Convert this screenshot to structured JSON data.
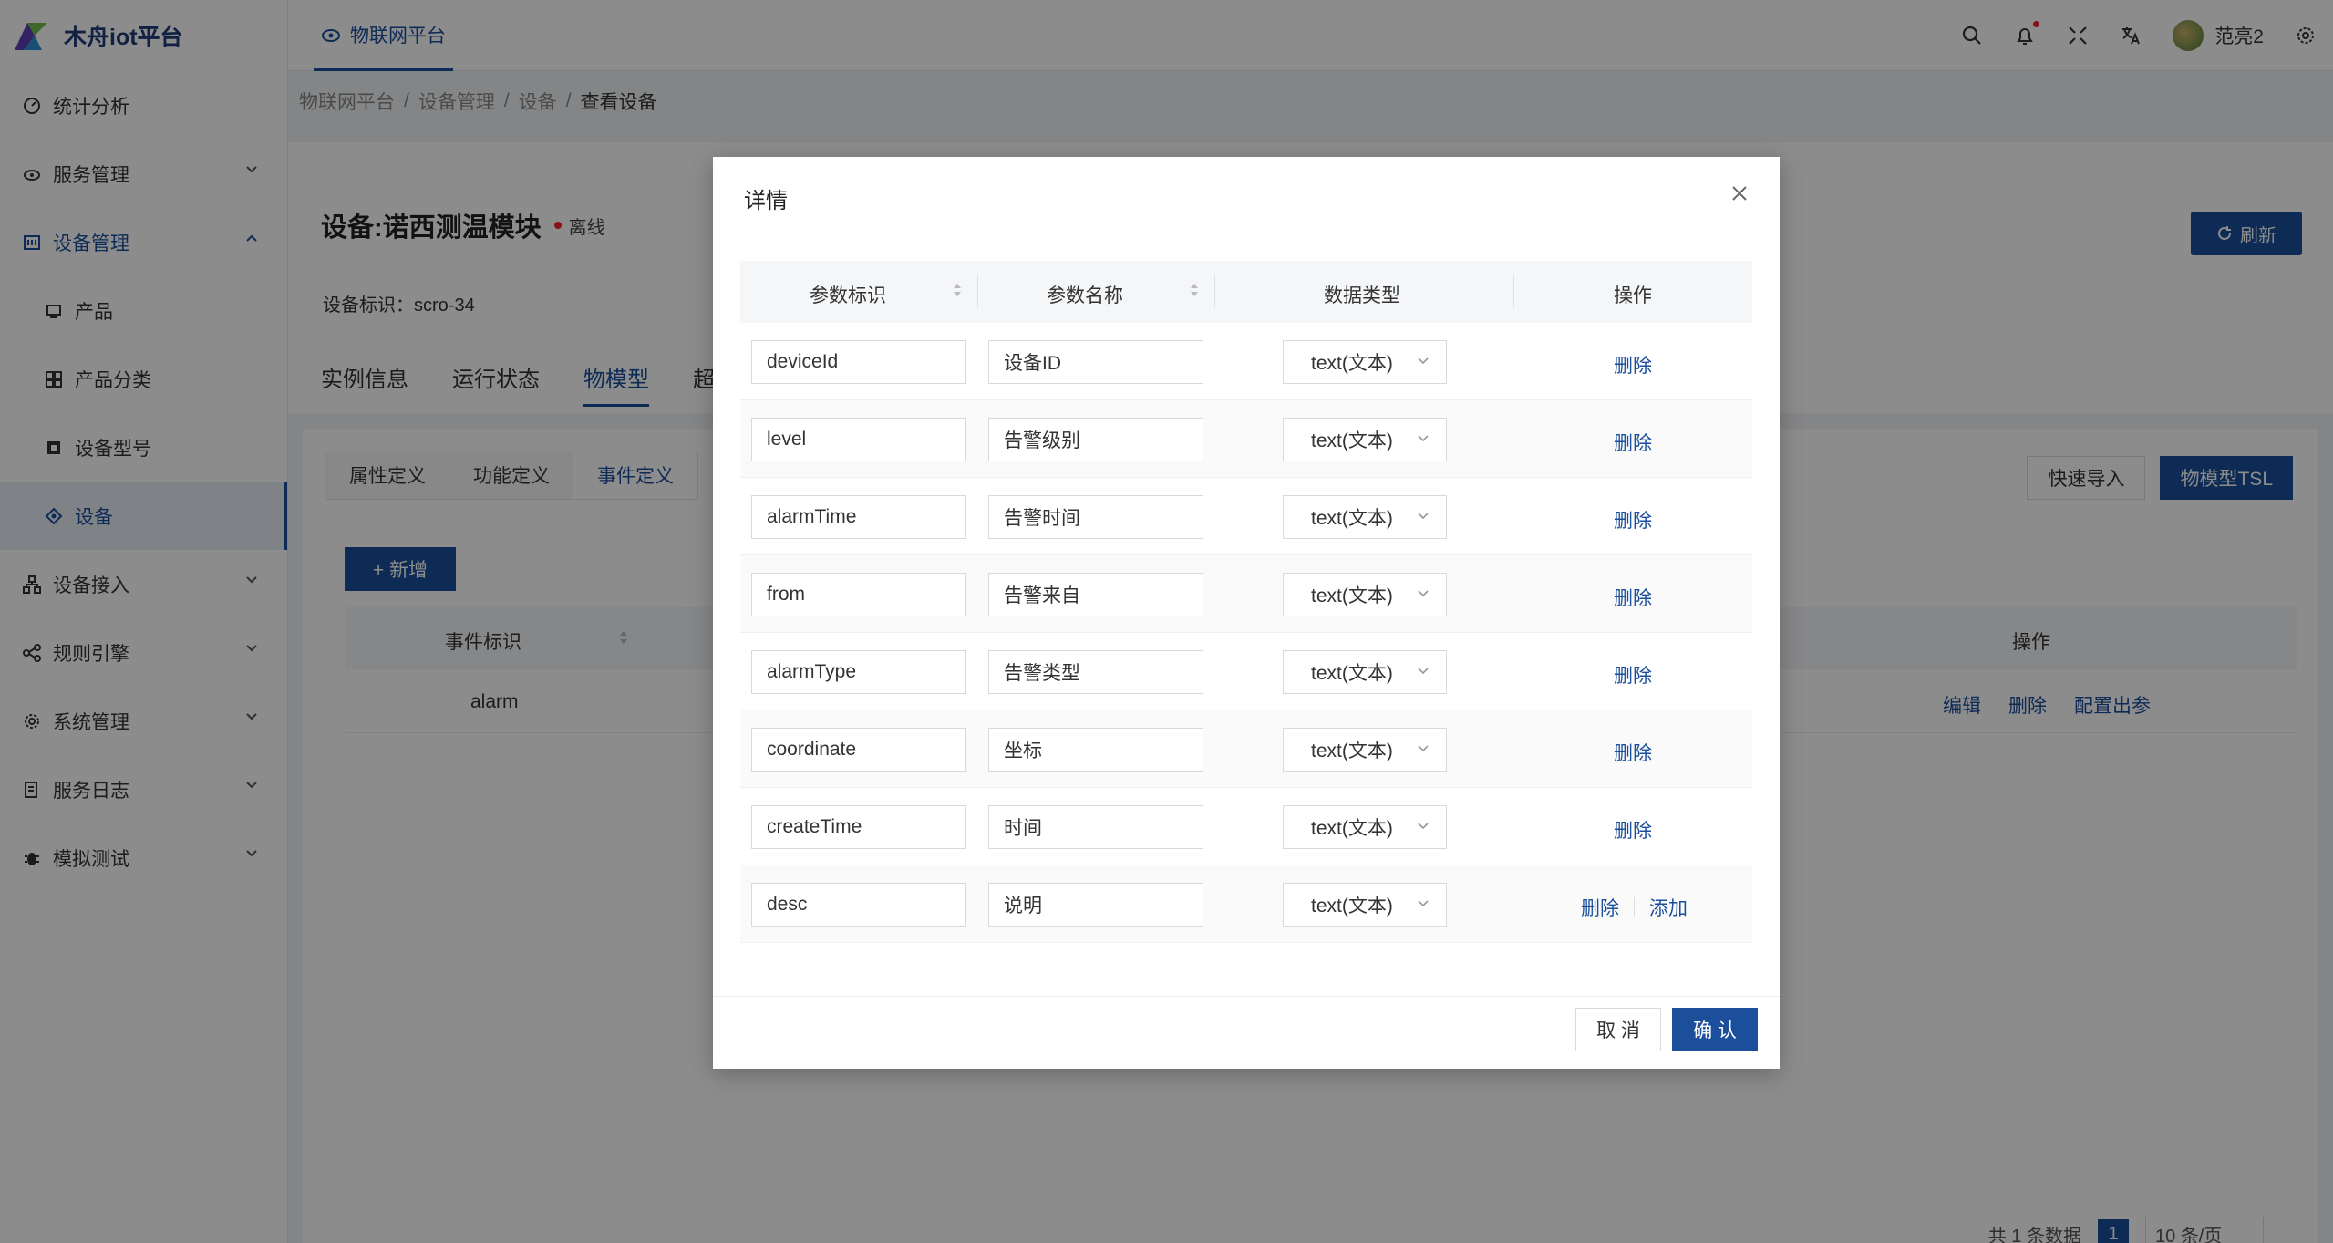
{
  "app": {
    "name": "木舟iot平台"
  },
  "sidebar": {
    "items": [
      {
        "label": "统计分析"
      },
      {
        "label": "服务管理"
      },
      {
        "label": "设备管理"
      },
      {
        "label": "产品"
      },
      {
        "label": "产品分类"
      },
      {
        "label": "设备型号"
      },
      {
        "label": "设备"
      },
      {
        "label": "设备接入"
      },
      {
        "label": "规则引擎"
      },
      {
        "label": "系统管理"
      },
      {
        "label": "服务日志"
      },
      {
        "label": "模拟测试"
      }
    ]
  },
  "topbar": {
    "tab": "物联网平台",
    "user": "范亮2"
  },
  "breadcrumb": [
    "物联网平台",
    "/",
    "设备管理",
    "/",
    "设备",
    "/",
    "查看设备"
  ],
  "device": {
    "title": "设备:诺西测温模块",
    "status": "离线",
    "id_label": "设备标识：scro-34",
    "refresh": "刷新"
  },
  "tabs": [
    "实例信息",
    "运行状态",
    "物模型",
    "超"
  ],
  "subtabs": [
    "属性定义",
    "功能定义",
    "事件定义"
  ],
  "card_actions": {
    "import": "快速导入",
    "tsl": "物模型TSL",
    "add": "+ 新增"
  },
  "events_table": {
    "col_id": "事件标识",
    "col_op": "操作",
    "rows": [
      {
        "id": "alarm",
        "actions": [
          "编辑",
          "删除",
          "配置出参"
        ]
      }
    ]
  },
  "pagination": {
    "total": "共 1 条数据",
    "page": "1",
    "size": "10 条/页"
  },
  "modal": {
    "title": "详情",
    "headers": {
      "param_id": "参数标识",
      "param_name": "参数名称",
      "data_type": "数据类型",
      "ops": "操作"
    },
    "rows": [
      {
        "id": "deviceId",
        "name": "设备ID",
        "type": "text(文本)",
        "ops": [
          "删除"
        ]
      },
      {
        "id": "level",
        "name": "告警级别",
        "type": "text(文本)",
        "ops": [
          "删除"
        ]
      },
      {
        "id": "alarmTime",
        "name": "告警时间",
        "type": "text(文本)",
        "ops": [
          "删除"
        ]
      },
      {
        "id": "from",
        "name": "告警来自",
        "type": "text(文本)",
        "ops": [
          "删除"
        ]
      },
      {
        "id": "alarmType",
        "name": "告警类型",
        "type": "text(文本)",
        "ops": [
          "删除"
        ]
      },
      {
        "id": "coordinate",
        "name": "坐标",
        "type": "text(文本)",
        "ops": [
          "删除"
        ]
      },
      {
        "id": "createTime",
        "name": "时间",
        "type": "text(文本)",
        "ops": [
          "删除"
        ]
      },
      {
        "id": "desc",
        "name": "说明",
        "type": "text(文本)",
        "ops": [
          "删除",
          "添加"
        ]
      }
    ],
    "cancel": "取 消",
    "ok": "确 认"
  },
  "colors": {
    "primary": "#1b4f9c",
    "danger": "#f5222d",
    "mask": "rgba(0,0,0,0.45)"
  }
}
